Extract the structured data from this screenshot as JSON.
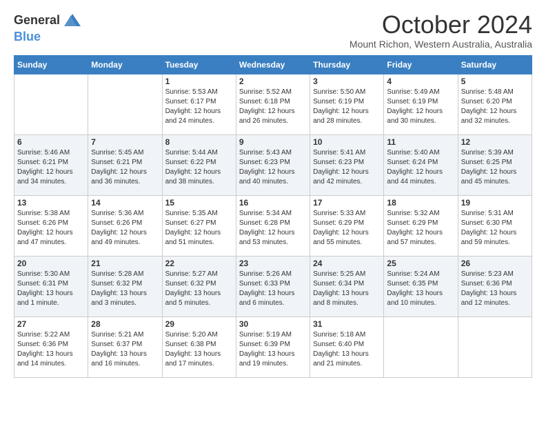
{
  "header": {
    "logo_general": "General",
    "logo_blue": "Blue",
    "month_title": "October 2024",
    "location": "Mount Richon, Western Australia, Australia"
  },
  "days_of_week": [
    "Sunday",
    "Monday",
    "Tuesday",
    "Wednesday",
    "Thursday",
    "Friday",
    "Saturday"
  ],
  "weeks": [
    [
      {
        "day": "",
        "info": ""
      },
      {
        "day": "",
        "info": ""
      },
      {
        "day": "1",
        "info": "Sunrise: 5:53 AM\nSunset: 6:17 PM\nDaylight: 12 hours and 24 minutes."
      },
      {
        "day": "2",
        "info": "Sunrise: 5:52 AM\nSunset: 6:18 PM\nDaylight: 12 hours and 26 minutes."
      },
      {
        "day": "3",
        "info": "Sunrise: 5:50 AM\nSunset: 6:19 PM\nDaylight: 12 hours and 28 minutes."
      },
      {
        "day": "4",
        "info": "Sunrise: 5:49 AM\nSunset: 6:19 PM\nDaylight: 12 hours and 30 minutes."
      },
      {
        "day": "5",
        "info": "Sunrise: 5:48 AM\nSunset: 6:20 PM\nDaylight: 12 hours and 32 minutes."
      }
    ],
    [
      {
        "day": "6",
        "info": "Sunrise: 5:46 AM\nSunset: 6:21 PM\nDaylight: 12 hours and 34 minutes."
      },
      {
        "day": "7",
        "info": "Sunrise: 5:45 AM\nSunset: 6:21 PM\nDaylight: 12 hours and 36 minutes."
      },
      {
        "day": "8",
        "info": "Sunrise: 5:44 AM\nSunset: 6:22 PM\nDaylight: 12 hours and 38 minutes."
      },
      {
        "day": "9",
        "info": "Sunrise: 5:43 AM\nSunset: 6:23 PM\nDaylight: 12 hours and 40 minutes."
      },
      {
        "day": "10",
        "info": "Sunrise: 5:41 AM\nSunset: 6:23 PM\nDaylight: 12 hours and 42 minutes."
      },
      {
        "day": "11",
        "info": "Sunrise: 5:40 AM\nSunset: 6:24 PM\nDaylight: 12 hours and 44 minutes."
      },
      {
        "day": "12",
        "info": "Sunrise: 5:39 AM\nSunset: 6:25 PM\nDaylight: 12 hours and 45 minutes."
      }
    ],
    [
      {
        "day": "13",
        "info": "Sunrise: 5:38 AM\nSunset: 6:26 PM\nDaylight: 12 hours and 47 minutes."
      },
      {
        "day": "14",
        "info": "Sunrise: 5:36 AM\nSunset: 6:26 PM\nDaylight: 12 hours and 49 minutes."
      },
      {
        "day": "15",
        "info": "Sunrise: 5:35 AM\nSunset: 6:27 PM\nDaylight: 12 hours and 51 minutes."
      },
      {
        "day": "16",
        "info": "Sunrise: 5:34 AM\nSunset: 6:28 PM\nDaylight: 12 hours and 53 minutes."
      },
      {
        "day": "17",
        "info": "Sunrise: 5:33 AM\nSunset: 6:29 PM\nDaylight: 12 hours and 55 minutes."
      },
      {
        "day": "18",
        "info": "Sunrise: 5:32 AM\nSunset: 6:29 PM\nDaylight: 12 hours and 57 minutes."
      },
      {
        "day": "19",
        "info": "Sunrise: 5:31 AM\nSunset: 6:30 PM\nDaylight: 12 hours and 59 minutes."
      }
    ],
    [
      {
        "day": "20",
        "info": "Sunrise: 5:30 AM\nSunset: 6:31 PM\nDaylight: 13 hours and 1 minute."
      },
      {
        "day": "21",
        "info": "Sunrise: 5:28 AM\nSunset: 6:32 PM\nDaylight: 13 hours and 3 minutes."
      },
      {
        "day": "22",
        "info": "Sunrise: 5:27 AM\nSunset: 6:32 PM\nDaylight: 13 hours and 5 minutes."
      },
      {
        "day": "23",
        "info": "Sunrise: 5:26 AM\nSunset: 6:33 PM\nDaylight: 13 hours and 6 minutes."
      },
      {
        "day": "24",
        "info": "Sunrise: 5:25 AM\nSunset: 6:34 PM\nDaylight: 13 hours and 8 minutes."
      },
      {
        "day": "25",
        "info": "Sunrise: 5:24 AM\nSunset: 6:35 PM\nDaylight: 13 hours and 10 minutes."
      },
      {
        "day": "26",
        "info": "Sunrise: 5:23 AM\nSunset: 6:36 PM\nDaylight: 13 hours and 12 minutes."
      }
    ],
    [
      {
        "day": "27",
        "info": "Sunrise: 5:22 AM\nSunset: 6:36 PM\nDaylight: 13 hours and 14 minutes."
      },
      {
        "day": "28",
        "info": "Sunrise: 5:21 AM\nSunset: 6:37 PM\nDaylight: 13 hours and 16 minutes."
      },
      {
        "day": "29",
        "info": "Sunrise: 5:20 AM\nSunset: 6:38 PM\nDaylight: 13 hours and 17 minutes."
      },
      {
        "day": "30",
        "info": "Sunrise: 5:19 AM\nSunset: 6:39 PM\nDaylight: 13 hours and 19 minutes."
      },
      {
        "day": "31",
        "info": "Sunrise: 5:18 AM\nSunset: 6:40 PM\nDaylight: 13 hours and 21 minutes."
      },
      {
        "day": "",
        "info": ""
      },
      {
        "day": "",
        "info": ""
      }
    ]
  ]
}
